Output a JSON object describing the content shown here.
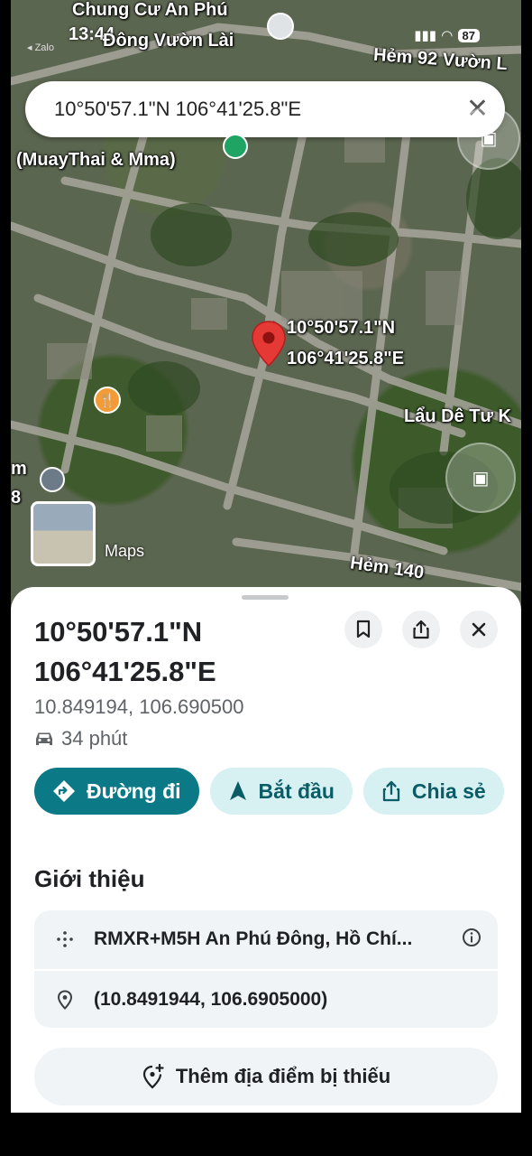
{
  "status_bar": {
    "time": "13:44",
    "back_app": "◂ Zalo",
    "battery": "87"
  },
  "search": {
    "query": "10°50'57.1\"N 106°41'25.8\"E"
  },
  "map": {
    "labels": {
      "top_place_line1": "Chung Cư An Phú",
      "top_place_line2": "Đông Vườn Lài",
      "alley_92": "Hẻm 92 Vườn L",
      "gym": "(MuayThai & Mma)",
      "pin_lat": "10°50'57.1\"N",
      "pin_lng": "106°41'25.8\"E",
      "restaurant": "Lẩu Dê Tư K",
      "alley_140": "Hẻm 140",
      "edge_m": "m",
      "edge_8": "8",
      "maps_logo": "Maps"
    }
  },
  "place": {
    "title": "10°50'57.1\"N 106°41'25.8\"E",
    "decimal_coords": "10.849194, 106.690500",
    "travel_time": "34 phút",
    "actions": {
      "directions": "Đường đi",
      "start": "Bắt đầu",
      "share": "Chia sẻ"
    },
    "about_title": "Giới thiệu",
    "plus_code": "RMXR+M5H An Phú Đông, Hồ Chí...",
    "precise_coords": "(10.8491944, 106.6905000)",
    "add_missing_place": "Thêm địa điểm bị thiếu"
  },
  "colors": {
    "primary_chip": "#0b7a86",
    "secondary_chip": "#d7f1f3",
    "pin_red": "#e53935",
    "card_bg": "#f0f4f7"
  },
  "icons": [
    "bookmark-icon",
    "share-icon",
    "close-icon",
    "car-icon",
    "directions-icon",
    "navigation-arrow-icon",
    "plus-code-icon",
    "location-pin-icon",
    "add-location-icon",
    "info-icon"
  ]
}
